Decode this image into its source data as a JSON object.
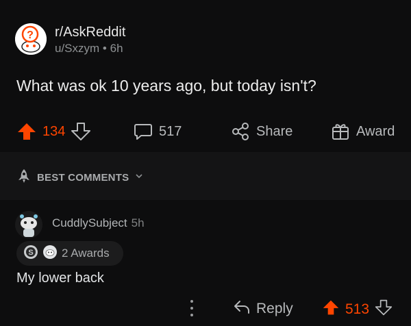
{
  "post": {
    "subreddit": "r/AskReddit",
    "author": "u/Sxzym",
    "separator": "•",
    "age": "6h",
    "title": "What was ok 10 years ago, but today isn't?",
    "upvotes": "134",
    "comments": "517",
    "share_label": "Share",
    "award_label": "Award"
  },
  "sort": {
    "label": "BEST COMMENTS"
  },
  "comment": {
    "username": "CuddlySubject",
    "age": "5h",
    "awards_text": "2 Awards",
    "body": "My lower back",
    "reply_label": "Reply",
    "votes": "513"
  },
  "colors": {
    "upvote": "#ff4500",
    "background": "#0d0d0e",
    "band": "#141415"
  },
  "icons": [
    "subreddit-avatar",
    "upvote-arrow",
    "downvote-arrow",
    "comment-bubble",
    "share-icon",
    "award-gift-icon",
    "rocket-icon",
    "chevron-down-icon",
    "user-avatar",
    "silver-award-icon",
    "helpful-award-icon",
    "more-dots-icon",
    "reply-arrow-icon"
  ]
}
